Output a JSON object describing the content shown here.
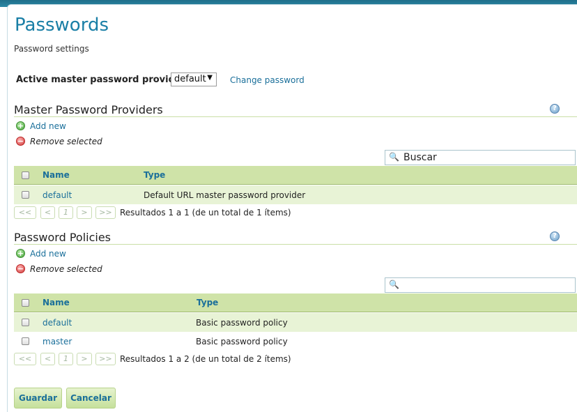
{
  "page": {
    "title": "Passwords",
    "subtitle": "Password settings"
  },
  "provider": {
    "label": "Active master password provider",
    "selected": "default",
    "change_link": "Change password"
  },
  "masterProviders": {
    "title": "Master Password Providers",
    "add_label": "Add new",
    "remove_label": "Remove selected",
    "search_value": "Buscar",
    "search_placeholder": "",
    "columns": [
      "Name",
      "Type"
    ],
    "rows": [
      {
        "name": "default",
        "type": "Default URL master password provider"
      }
    ],
    "pager": {
      "first": "<<",
      "prev": "<",
      "page": "1",
      "next": ">",
      "last": ">>"
    },
    "results": "Resultados 1 a 1 (de un total de 1 ítems)"
  },
  "policies": {
    "title": "Password Policies",
    "add_label": "Add new",
    "remove_label": "Remove selected",
    "search_value": "",
    "columns": [
      "Name",
      "Type"
    ],
    "rows": [
      {
        "name": "default",
        "type": "Basic password policy"
      },
      {
        "name": "master",
        "type": "Basic password policy"
      }
    ],
    "pager": {
      "first": "<<",
      "prev": "<",
      "page": "1",
      "next": ">",
      "last": ">>"
    },
    "results": "Resultados 1 a 2 (de un total de 2 ítems)"
  },
  "buttons": {
    "save": "Guardar",
    "cancel": "Cancelar"
  },
  "icons": {
    "add": "plus-circle-icon",
    "remove": "minus-circle-icon",
    "help": "question-icon",
    "search": "magnifier-icon"
  },
  "colors": {
    "title": "#1a7fa6",
    "table_header": "#cfe3a8",
    "row_alt": "#e8f3d6",
    "link": "#1a6f9a"
  }
}
